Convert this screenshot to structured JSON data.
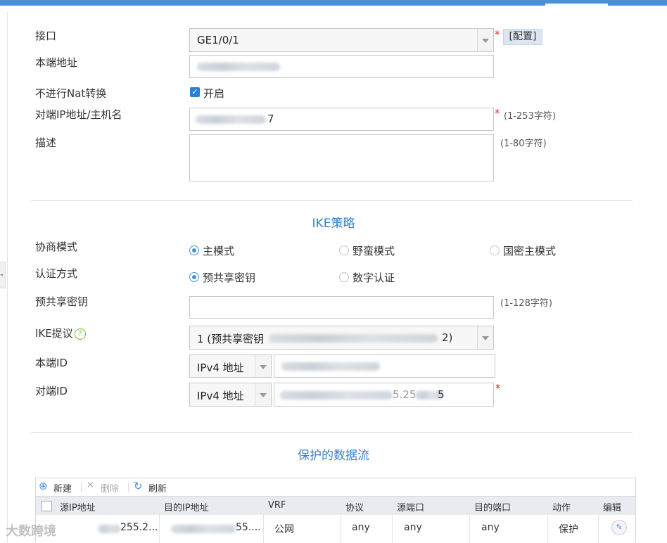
{
  "form": {
    "interface": {
      "label": "接口",
      "value": "GE1/0/1",
      "config_btn": "[配置]"
    },
    "local_addr": {
      "label": "本端地址"
    },
    "no_nat": {
      "label": "不进行Nat转换",
      "checkbox_label": "开启"
    },
    "peer_addr": {
      "label": "对端IP地址/主机名",
      "value_tail": "7",
      "hint": "(1-253字符)"
    },
    "desc": {
      "label": "描述",
      "hint": "(1-80字符)"
    }
  },
  "ike": {
    "title": "IKE策略",
    "negotiation": {
      "label": "协商模式",
      "options": [
        "主模式",
        "野蛮模式",
        "国密主模式"
      ]
    },
    "auth": {
      "label": "认证方式",
      "options": [
        "预共享密钥",
        "数字认证"
      ]
    },
    "psk": {
      "label": "预共享密钥",
      "hint": "(1-128字符)"
    },
    "proposal": {
      "label": "IKE提议",
      "help": "?",
      "value_prefix": "1 (预共享密钥",
      "value_suffix": "2)"
    },
    "local_id": {
      "label": "本端ID",
      "type": "IPv4 地址"
    },
    "peer_id": {
      "label": "对端ID",
      "type": "IPv4 地址",
      "value_frag": "5.25",
      "value_end": "5"
    }
  },
  "flows": {
    "title": "保护的数据流",
    "toolbar": {
      "new": "新建",
      "delete": "删除",
      "refresh": "刷新"
    },
    "columns": [
      "源IP地址",
      "目的IP地址",
      "VRF",
      "协议",
      "源端口",
      "目的端口",
      "动作",
      "编辑"
    ],
    "row": {
      "src": "255.2...",
      "dst": "55....",
      "vrf": "公网",
      "proto": "any",
      "sport": "any",
      "dport": "any",
      "action": "保护"
    }
  },
  "watermark": "大数跨境",
  "colors": {
    "accent": "#4a90d9",
    "title_blue": "#3a7fc8",
    "required": "#e02020"
  }
}
